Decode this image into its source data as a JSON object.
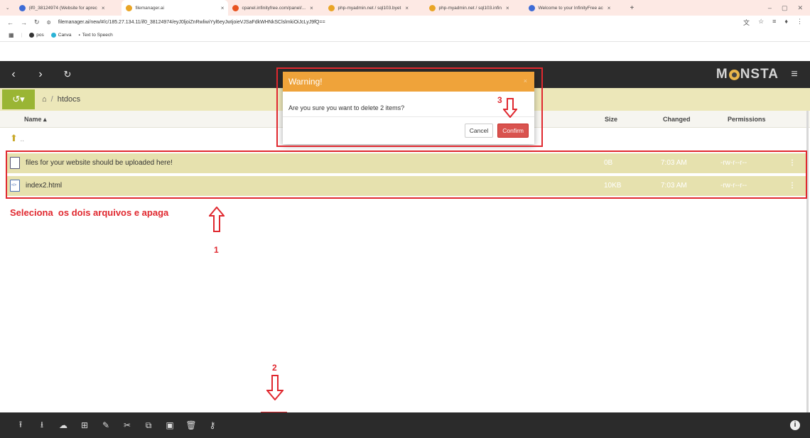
{
  "browser": {
    "tabs": [
      {
        "label": "(if0_38124974 (Website for aprec",
        "color": "#3e6bd6"
      },
      {
        "label": "filemanager.ai",
        "color": "#e9a526"
      },
      {
        "label": "cpanel.infinityfree.com/panel/...",
        "color": "#e8531f"
      },
      {
        "label": "php-myadmin.net / sql103.byet",
        "color": "#e9a526"
      },
      {
        "label": "php-myadmin.net / sql103.infin",
        "color": "#e9a526"
      },
      {
        "label": "Welcome to your InfinityFree ac",
        "color": "#3e6bd6"
      }
    ],
    "new_tab": "+",
    "url": "filemanager.ai/new/#/c/185.27.134.11/if0_38124974/eyJ0ljoiZnRwliwiYyl6eyJwIjoieVJSaFdkWHNkSClslmkiOiJcLyJ9fQ==",
    "bookmarks": [
      {
        "label": "pos",
        "color": "#333333"
      },
      {
        "label": "Canva",
        "color": "#2bb3d6"
      },
      {
        "label": "Text to Speech",
        "color": "#555555"
      }
    ]
  },
  "header": {
    "logo": "MONSTA",
    "back_icon": "chevron-left-icon",
    "forward_icon": "chevron-right-icon",
    "refresh_icon": "refresh-icon",
    "menu_icon": "hamburger-icon"
  },
  "breadcrumb": {
    "separator": "/",
    "folder": "htdocs"
  },
  "columns": {
    "name": "Name ▴",
    "size": "Size",
    "changed": "Changed",
    "permissions": "Permissions"
  },
  "updir": "..",
  "files": [
    {
      "name": "files for your website should be uploaded here!",
      "size": "0B",
      "changed": "7:03 AM",
      "permissions": "-rw-r--r--",
      "icon": "file-icon"
    },
    {
      "name": "index2.html",
      "size": "10KB",
      "changed": "7:03 AM",
      "permissions": "-rw-r--r--",
      "icon": "code-file-icon"
    }
  ],
  "modal": {
    "title": "Warning!",
    "close": "×",
    "message": "Are you sure you want to delete 2 items?",
    "cancel": "Cancel",
    "confirm": "Confirm"
  },
  "annotations": {
    "instruction": "Seleciona  os dois arquivos e apaga",
    "step1": "1",
    "step2": "2",
    "step3": "3",
    "color": "#e0282f"
  },
  "toolbar_icons": [
    "upload-file-icon",
    "download-icon",
    "cloud-upload-icon",
    "new-folder-icon",
    "rename-icon",
    "cut-icon",
    "copy-icon",
    "paste-icon",
    "delete-icon",
    "key-icon"
  ],
  "colors": {
    "header_bg": "#2b2b2b",
    "selection": "#e6e1ae",
    "modal_header": "#efa33a",
    "confirm_button": "#d9534f"
  }
}
